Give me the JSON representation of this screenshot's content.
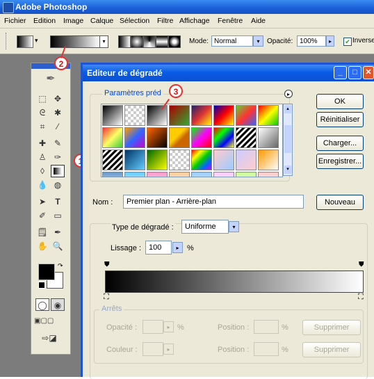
{
  "app": {
    "title": "Adobe Photoshop"
  },
  "menu": [
    "Fichier",
    "Edition",
    "Image",
    "Calque",
    "Sélection",
    "Filtre",
    "Affichage",
    "Fenêtre",
    "Aide"
  ],
  "options": {
    "mode_label": "Mode:",
    "mode_value": "Normal",
    "opacity_label": "Opacité:",
    "opacity_value": "100%",
    "inverse_label": "Inverse"
  },
  "dialog": {
    "title": "Editeur de dégradé",
    "presets_legend": "Paramètres préd",
    "buttons": {
      "ok": "OK",
      "reset": "Réinitialiser",
      "load": "Charger...",
      "save": "Enregistrer...",
      "new": "Nouveau"
    },
    "name_label": "Nom :",
    "name_value": "Premier plan - Arrière-plan",
    "type_label": "Type de dégradé :",
    "type_value": "Uniforme",
    "smooth_label": "Lissage :",
    "smooth_value": "100",
    "smooth_unit": "%",
    "stops": {
      "legend": "Arrêts",
      "opacity_label": "Opacité :",
      "opacity_unit": "%",
      "position_label": "Position :",
      "position_unit": "%",
      "delete_label": "Supprimer",
      "color_label": "Couleur :"
    }
  },
  "callouts": [
    "1",
    "2",
    "3"
  ],
  "presets": [
    "linear-gradient(135deg,#000,#fff)",
    "repeating-conic-gradient(#ccc 0 25%,#fff 0 50%) 0 0/8px 8px",
    "linear-gradient(135deg,#000,#fff)",
    "linear-gradient(135deg,#a00,#3a3)",
    "linear-gradient(135deg,#226,#d33,#ff0)",
    "linear-gradient(135deg,#00a,#f00,#ff0)",
    "linear-gradient(135deg,#6c3,#f33,#36f)",
    "linear-gradient(135deg,#f00,#ff0,#0c0)",
    "linear-gradient(135deg,#f33,#ff6,#3c3)",
    "linear-gradient(135deg,#f90,#36f,#c0c)",
    "linear-gradient(135deg,#f60,#000)",
    "linear-gradient(135deg,#fc0 40%,#c60 60%)",
    "linear-gradient(135deg,#0f0,#f0f,#f00)",
    "linear-gradient(135deg,#f00,#0f0,#00f,#ff0)",
    "repeating-linear-gradient(135deg,#000 0 3px,#fff 3px 6px)",
    "linear-gradient(135deg,#fff,#666)",
    "repeating-linear-gradient(135deg,#000 0 3px,#fff 3px 6px)",
    "linear-gradient(135deg,#036,#6cf)",
    "linear-gradient(135deg,#060,#ff0)",
    "repeating-conic-gradient(#ccc 0 25%,#fff 0 50%) 0 0/8px 8px",
    "linear-gradient(135deg,#f00,#ff0,#0c0,#06f,#c0f)",
    "linear-gradient(135deg,#fcc,#9cf)",
    "linear-gradient(135deg,#ccf,#fcc)",
    "linear-gradient(135deg,#f90,#fff)",
    "linear-gradient(#69c,#fff)",
    "linear-gradient(#6cf,#fff)",
    "linear-gradient(#f9c,#fff)",
    "linear-gradient(#fc9,#fff)",
    "linear-gradient(#9cf,#fff)",
    "linear-gradient(#fcf,#fff)",
    "linear-gradient(#cf9,#fff)",
    "linear-gradient(#fcc,#fff)"
  ],
  "colors": {
    "accent_blue": "#0a5ce6",
    "dialog_bg": "#ece9d8",
    "callout": "#e23333",
    "workspace": "#7c7c7c"
  }
}
